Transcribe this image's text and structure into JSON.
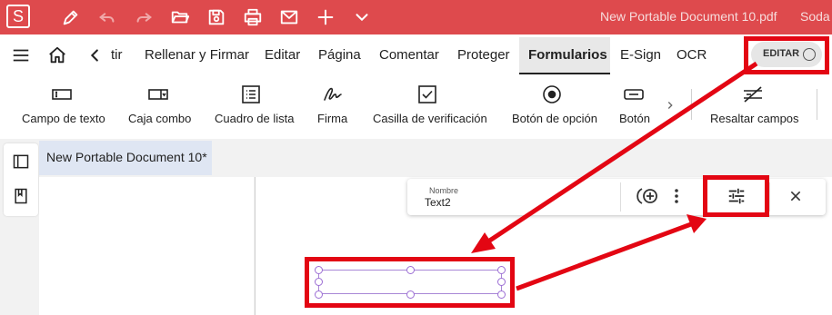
{
  "titlebar": {
    "logo": "S",
    "document_title": "New Portable Document 10.pdf",
    "app_name": "Soda",
    "icons": [
      "pen-icon",
      "undo-icon",
      "redo-icon",
      "open-folder-icon",
      "save-icon",
      "print-icon",
      "mail-icon",
      "add-icon",
      "chevron-down-icon"
    ],
    "bg_color": "#de4a4d"
  },
  "menubar": {
    "items": [
      {
        "label": "tir"
      },
      {
        "label": "Rellenar y Firmar"
      },
      {
        "label": "Editar"
      },
      {
        "label": "Página"
      },
      {
        "label": "Comentar"
      },
      {
        "label": "Proteger"
      },
      {
        "label": "Formularios",
        "active": true
      },
      {
        "label": "E-Sign"
      },
      {
        "label": "OCR"
      }
    ],
    "editar_toggle": "EDITAR"
  },
  "toolbar": {
    "tools": [
      {
        "label": "Campo de texto",
        "icon": "text-field-icon"
      },
      {
        "label": "Caja combo",
        "icon": "combo-box-icon"
      },
      {
        "label": "Cuadro de lista",
        "icon": "list-box-icon"
      },
      {
        "label": "Firma",
        "icon": "signature-icon"
      },
      {
        "label": "Casilla de verificación",
        "icon": "checkbox-icon"
      },
      {
        "label": "Botón de opción",
        "icon": "radio-button-icon"
      },
      {
        "label": "Botón",
        "icon": "button-icon"
      },
      {
        "label": "Resaltar campos",
        "icon": "highlight-fields-icon"
      }
    ]
  },
  "document": {
    "tab_label": "New Portable Document 10*",
    "field_caption": "Nombre",
    "field_name": "Text2"
  },
  "colors": {
    "annotation_red": "#e30613",
    "field_border": "#a987d6",
    "tab_highlight": "#dfe6f3"
  }
}
